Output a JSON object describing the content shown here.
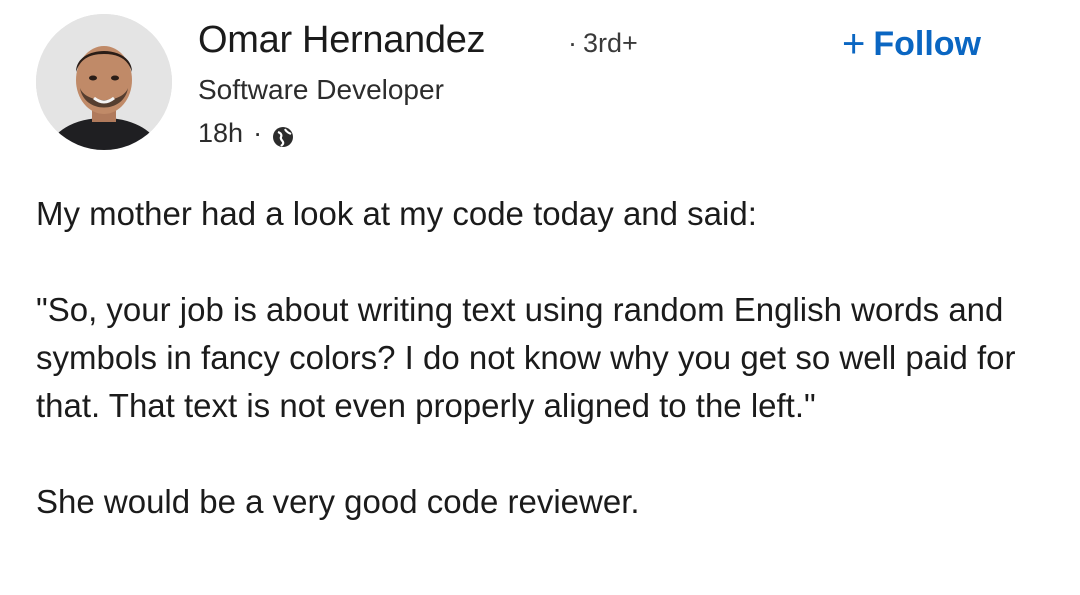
{
  "author": {
    "name": "Omar Hernandez",
    "degree": "3rd+",
    "degree_separator": "·",
    "headline": "Software Developer",
    "time": "18h",
    "meta_separator": "·",
    "visibility_icon": "globe-icon",
    "avatar_icon": "avatar"
  },
  "follow": {
    "plus": "+",
    "label": "Follow",
    "color": "#0a66c2"
  },
  "post": {
    "paragraphs": [
      "My mother had a look at my code today and said:",
      "\"So, your job is about writing text using random English words and symbols in fancy colors? I do not know why you get so well paid for that. That text is not even properly aligned to the left.\"",
      "She would be a very good code reviewer."
    ]
  }
}
